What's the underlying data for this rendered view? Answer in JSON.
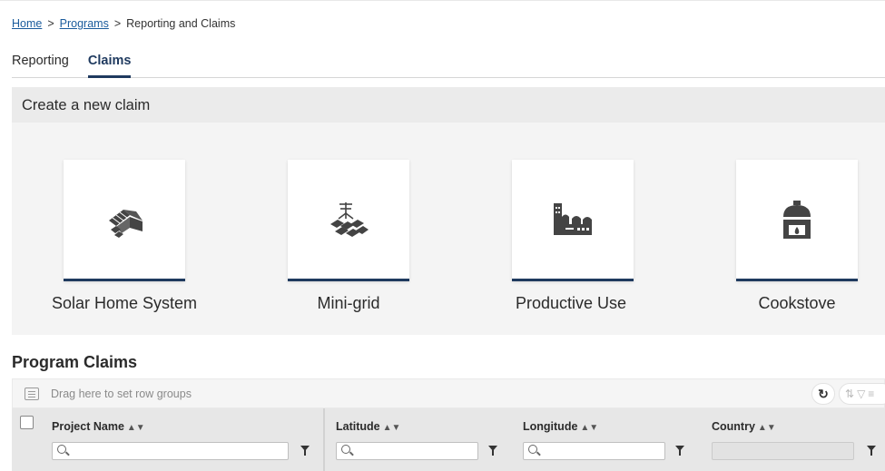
{
  "breadcrumb": {
    "home": "Home",
    "sep1": ">",
    "programs": "Programs",
    "sep2": ">",
    "current": "Reporting and Claims"
  },
  "tabs": [
    {
      "label": "Reporting",
      "active": false
    },
    {
      "label": "Claims",
      "active": true
    }
  ],
  "create_claim": {
    "title": "Create a new claim",
    "cards": [
      {
        "label": "Solar Home System",
        "icon": "solar-home-icon"
      },
      {
        "label": "Mini-grid",
        "icon": "mini-grid-icon"
      },
      {
        "label": "Productive Use",
        "icon": "factory-icon"
      },
      {
        "label": "Cookstove",
        "icon": "cookstove-icon"
      }
    ]
  },
  "program_claims": {
    "title": "Program Claims",
    "group_hint": "Drag here to set row groups",
    "columns": [
      {
        "title": "Project Name",
        "sort": "▲▼",
        "filter_enabled": true
      },
      {
        "title": "Latitude",
        "sort": "▲▼",
        "filter_enabled": true
      },
      {
        "title": "Longitude",
        "sort": "▲▼",
        "filter_enabled": true
      },
      {
        "title": "Country",
        "sort": "▲▼",
        "filter_enabled": false
      }
    ]
  },
  "colors": {
    "accent": "#1f3a5f",
    "link": "#1a5b9c",
    "panel": "#f4f4f4"
  }
}
